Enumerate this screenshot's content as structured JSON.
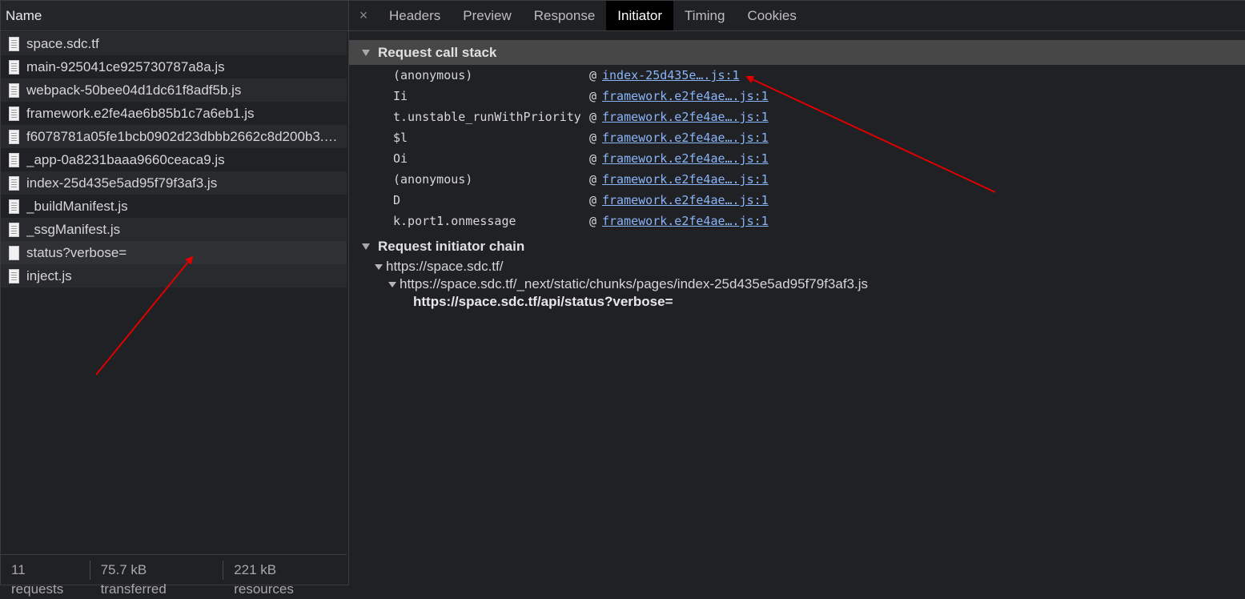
{
  "left_panel": {
    "header": "Name",
    "files": [
      {
        "name": "space.sdc.tf"
      },
      {
        "name": "main-925041ce925730787a8a.js"
      },
      {
        "name": "webpack-50bee04d1dc61f8adf5b.js"
      },
      {
        "name": "framework.e2fe4ae6b85b1c7a6eb1.js"
      },
      {
        "name": "f6078781a05fe1bcb0902d23dbbb2662c8d200b3.9…"
      },
      {
        "name": "_app-0a8231baaa9660ceaca9.js"
      },
      {
        "name": "index-25d435e5ad95f79f3af3.js"
      },
      {
        "name": "_buildManifest.js"
      },
      {
        "name": "_ssgManifest.js"
      },
      {
        "name": "status?verbose="
      },
      {
        "name": "inject.js"
      }
    ],
    "status": {
      "requests": "11 requests",
      "transferred": "75.7 kB transferred",
      "resources": "221 kB resources"
    }
  },
  "tabs": {
    "close": "×",
    "items": [
      "Headers",
      "Preview",
      "Response",
      "Initiator",
      "Timing",
      "Cookies"
    ],
    "active": "Initiator"
  },
  "call_stack": {
    "title": "Request call stack",
    "rows": [
      {
        "fn": "(anonymous)",
        "at": "@",
        "src": "index-25d435e….js:1"
      },
      {
        "fn": "Ii",
        "at": "@",
        "src": "framework.e2fe4ae….js:1"
      },
      {
        "fn": "t.unstable_runWithPriority",
        "at": "@",
        "src": "framework.e2fe4ae….js:1"
      },
      {
        "fn": "$l",
        "at": "@",
        "src": "framework.e2fe4ae….js:1"
      },
      {
        "fn": "Oi",
        "at": "@",
        "src": "framework.e2fe4ae….js:1"
      },
      {
        "fn": "(anonymous)",
        "at": "@",
        "src": "framework.e2fe4ae….js:1"
      },
      {
        "fn": "D",
        "at": "@",
        "src": "framework.e2fe4ae….js:1"
      },
      {
        "fn": "k.port1.onmessage",
        "at": "@",
        "src": "framework.e2fe4ae….js:1"
      }
    ]
  },
  "initiator_chain": {
    "title": "Request initiator chain",
    "items": [
      "https://space.sdc.tf/",
      "https://space.sdc.tf/_next/static/chunks/pages/index-25d435e5ad95f79f3af3.js",
      "https://space.sdc.tf/api/status?verbose="
    ]
  },
  "colors": {
    "background": "#202124",
    "link": "#8ab4f8",
    "annotation_arrow": "#e00000",
    "active_tab": "#000000"
  }
}
